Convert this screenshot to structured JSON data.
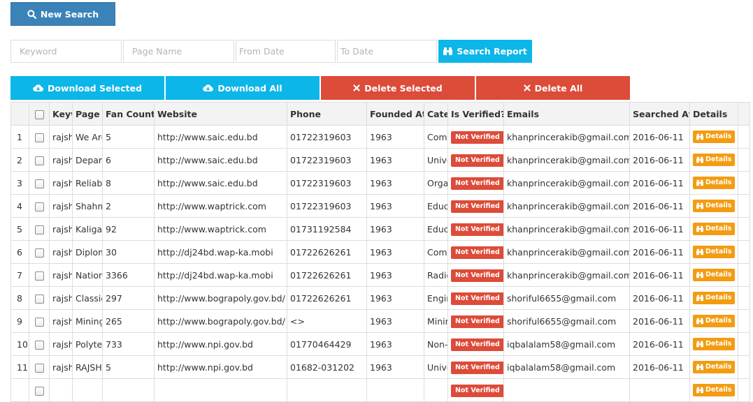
{
  "toolbar": {
    "new_search_label": "New Search",
    "search_report_label": "Search Report",
    "download_selected_label": "Download Selected",
    "download_all_label": "Download All",
    "delete_selected_label": "Delete Selected",
    "delete_all_label": "Delete All"
  },
  "filters": {
    "keyword_placeholder": "Keyword",
    "page_name_placeholder": "Page Name",
    "from_date_placeholder": "From Date",
    "to_date_placeholder": "To Date"
  },
  "table": {
    "headers": [
      "",
      "",
      "Keyword",
      "Page Name",
      "Fan Count",
      "Website",
      "Phone",
      "Founded At",
      "Category",
      "Is Verified?",
      "Emails",
      "Searched At",
      "Details",
      ""
    ],
    "verified_label": "Not Verified",
    "details_label": "Details",
    "rows": [
      {
        "num": "1",
        "keyword": "rajshahi",
        "page": "We Are",
        "fans": "5",
        "website": "http://www.saic.edu.bd",
        "phone": "01722319603",
        "founded": "1963",
        "category": "Community",
        "email": "khanprincerakib@gmail.com",
        "searched": "2016-06-11"
      },
      {
        "num": "2",
        "keyword": "rajshahi",
        "page": "Department",
        "fans": "6",
        "website": "http://www.saic.edu.bd",
        "phone": "01722319603",
        "founded": "1963",
        "category": "University",
        "email": "khanprincerakib@gmail.com",
        "searched": "2016-06-11"
      },
      {
        "num": "3",
        "keyword": "rajshahi",
        "page": "Reliable",
        "fans": "8",
        "website": "http://www.saic.edu.bd",
        "phone": "01722319603",
        "founded": "1963",
        "category": "Organization",
        "email": "khanprincerakib@gmail.com",
        "searched": "2016-06-11"
      },
      {
        "num": "4",
        "keyword": "rajshahi",
        "page": "Shahmukhdum",
        "fans": "2",
        "website": "http://www.waptrick.com",
        "phone": "01722319603",
        "founded": "1963",
        "category": "Education",
        "email": "khanprincerakib@gmail.com",
        "searched": "2016-06-11"
      },
      {
        "num": "5",
        "keyword": "rajshahi",
        "page": "Kaligaon",
        "fans": "92",
        "website": "http://www.waptrick.com",
        "phone": "01731192584",
        "founded": "1963",
        "category": "Education",
        "email": "khanprincerakib@gmail.com",
        "searched": "2016-06-11"
      },
      {
        "num": "6",
        "keyword": "rajshahi",
        "page": "Diploma",
        "fans": "30",
        "website": "http://dj24bd.wap-ka.mobi",
        "phone": "01722626261",
        "founded": "1963",
        "category": "Community",
        "email": "khanprincerakib@gmail.com",
        "searched": "2016-06-11"
      },
      {
        "num": "7",
        "keyword": "rajshahi",
        "page": "National",
        "fans": "3366",
        "website": "http://dj24bd.wap-ka.mobi",
        "phone": "01722626261",
        "founded": "1963",
        "category": "Radio",
        "email": "khanprincerakib@gmail.com",
        "searched": "2016-06-11"
      },
      {
        "num": "8",
        "keyword": "rajshahi",
        "page": "Classic",
        "fans": "297",
        "website": "http://www.bograpoly.gov.bd/",
        "phone": "01722626261",
        "founded": "1963",
        "category": "Engineering",
        "email": "shoriful6655@gmail.com",
        "searched": "2016-06-11"
      },
      {
        "num": "9",
        "keyword": "rajshahi",
        "page": "Mining",
        "fans": "265",
        "website": "http://www.bograpoly.gov.bd/",
        "phone": "<>",
        "founded": "1963",
        "category": "Mining",
        "email": "shoriful6655@gmail.com",
        "searched": "2016-06-11"
      },
      {
        "num": "10",
        "keyword": "rajshahi",
        "page": "Polytechnic",
        "fans": "733",
        "website": "http://www.npi.gov.bd",
        "phone": "01770464429",
        "founded": "1963",
        "category": "Non-profit",
        "email": "iqbalalam58@gmail.com",
        "searched": "2016-06-11"
      },
      {
        "num": "11",
        "keyword": "rajshahi",
        "page": "RAJSHAHI",
        "fans": "5",
        "website": "http://www.npi.gov.bd",
        "phone": "01682-031202",
        "founded": "1963",
        "category": "University",
        "email": "iqbalalam58@gmail.com",
        "searched": "2016-06-11"
      },
      {
        "num": "",
        "keyword": "",
        "page": "",
        "fans": "",
        "website": "",
        "phone": "",
        "founded": "",
        "category": "",
        "email": "",
        "searched": ""
      }
    ]
  },
  "colors": {
    "primary": "#3b82b9",
    "info": "#0cb6e8",
    "danger": "#dd4b39",
    "warning": "#f39c12"
  }
}
